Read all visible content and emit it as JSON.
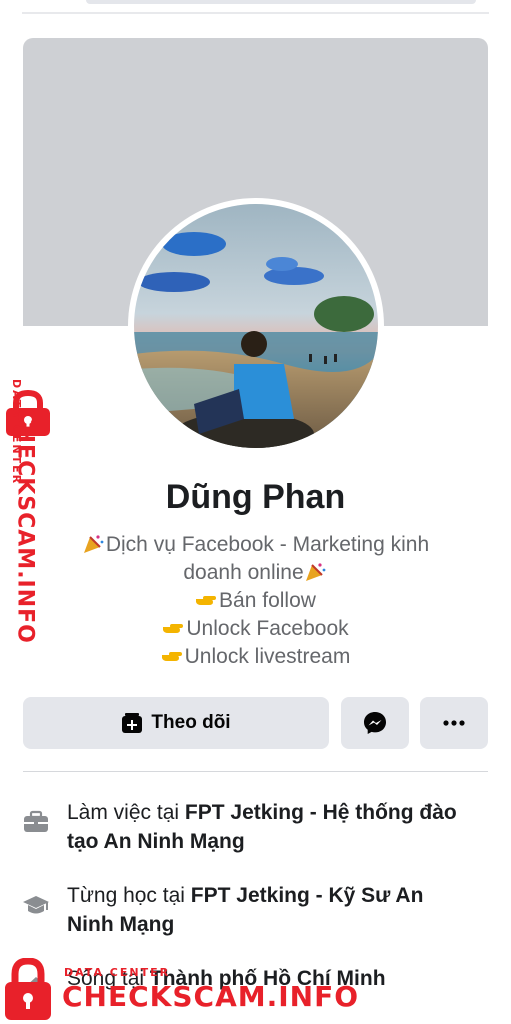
{
  "profile": {
    "name": "Dũng Phan",
    "bio": [
      {
        "emoji": "party",
        "text": "Dịch vụ Facebook - Marketing kinh",
        "trail": ""
      },
      {
        "emoji": "",
        "text": "doanh online",
        "trail": "party"
      },
      {
        "emoji": "point",
        "text": "Bán follow",
        "trail": ""
      },
      {
        "emoji": "point",
        "text": "Unlock Facebook",
        "trail": ""
      },
      {
        "emoji": "point",
        "text": "Unlock livestream",
        "trail": ""
      }
    ]
  },
  "actions": {
    "follow_label": "Theo dõi",
    "message_icon": "messenger-icon",
    "more_icon": "more-dots-icon"
  },
  "intro": {
    "work_prefix": "Làm việc tại ",
    "work_place": "FPT Jetking - Hệ thống đào tạo An Ninh Mạng",
    "study_prefix": "Từng học tại ",
    "study_place": "FPT Jetking - Kỹ Sư An Ninh Mạng",
    "live_prefix": "Sống tại ",
    "live_place": "Thành phố Hồ Chí Minh"
  },
  "watermark": {
    "small": "DATA CENTER",
    "brand": "CHECKSCAM.INFO"
  },
  "colors": {
    "watermark": "#e8212a",
    "button_bg": "#e4e6eb",
    "cover_bg": "#ced0d4"
  }
}
